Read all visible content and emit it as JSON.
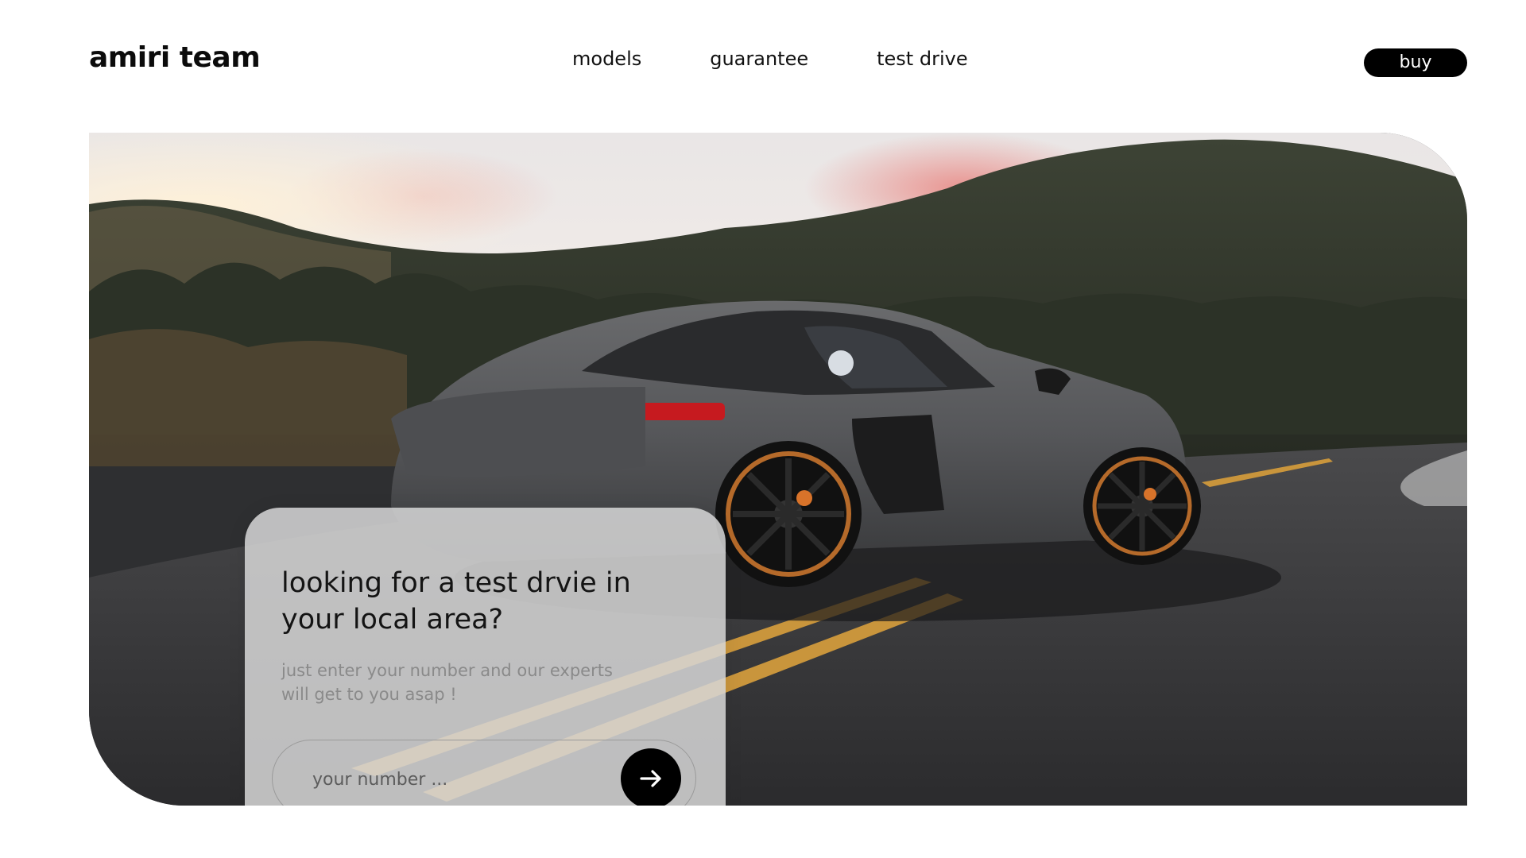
{
  "brand": {
    "logo_text": "amiri team"
  },
  "nav": {
    "items": [
      {
        "label": "models"
      },
      {
        "label": "guarantee"
      },
      {
        "label": "test drive"
      }
    ],
    "buy_label": "buy"
  },
  "hero": {
    "image_subject": "matte grey sports car on a mountain road at sunset",
    "card": {
      "title": "looking for a test drvie in your local area?",
      "subtitle": "just enter your number and our experts will get to you asap !",
      "input_placeholder": "your number ...",
      "input_value": "",
      "submit_icon": "arrow-right-icon"
    }
  },
  "colors": {
    "background": "#ffffff",
    "accent_dark": "#000000",
    "card_glass": "#d6d6d6",
    "subtitle_text": "#8a8a8a"
  }
}
